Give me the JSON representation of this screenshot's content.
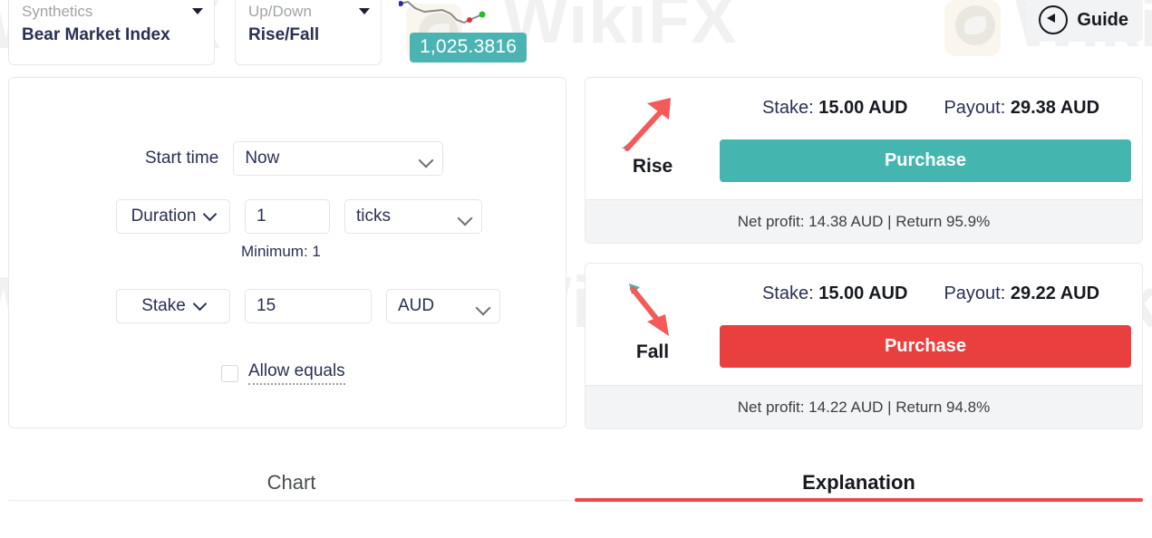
{
  "market_selector": {
    "category": "Synthetics",
    "name": "Bear Market Index",
    "caret_icon": "caret-down-icon"
  },
  "trade_type_selector": {
    "category": "Up/Down",
    "name": "Rise/Fall",
    "caret_icon": "caret-down-icon"
  },
  "ticker": {
    "price": "1,025.3816",
    "badge_color": "#4bb4b3",
    "sparkline_icon": "sparkline-chart"
  },
  "guide": {
    "label": "Guide",
    "icon": "play-circle-icon"
  },
  "form": {
    "start_time": {
      "label": "Start time",
      "value": "Now",
      "chevron_icon": "chevron-down-icon"
    },
    "duration": {
      "type_label": "Duration",
      "type_chevron_icon": "chevron-down-icon",
      "value": "1",
      "unit": "ticks",
      "unit_chevron_icon": "chevron-down-icon",
      "minimum_note": "Minimum: 1"
    },
    "stake": {
      "type_label": "Stake",
      "type_chevron_icon": "chevron-down-icon",
      "value": "15",
      "currency": "AUD",
      "currency_chevron_icon": "chevron-down-icon"
    },
    "allow_equals": {
      "label": "Allow equals",
      "checked": false,
      "checkbox_icon": "checkbox-unchecked-icon"
    }
  },
  "contracts": [
    {
      "direction": "Rise",
      "direction_icon": "arrow-up-right-icon",
      "stake_label": "Stake:",
      "stake_value": "15.00 AUD",
      "payout_label": "Payout:",
      "payout_value": "29.38 AUD",
      "button_label": "Purchase",
      "button_color": "#45b5b0",
      "footer": "Net profit: 14.38 AUD | Return 95.9%"
    },
    {
      "direction": "Fall",
      "direction_icon": "arrow-down-right-icon",
      "stake_label": "Stake:",
      "stake_value": "15.00 AUD",
      "payout_label": "Payout:",
      "payout_value": "29.22 AUD",
      "button_label": "Purchase",
      "button_color": "#ea3f3f",
      "footer": "Net profit: 14.22 AUD | Return 94.8%"
    }
  ],
  "tabs": {
    "chart": "Chart",
    "explanation": "Explanation",
    "active": "Explanation",
    "active_underline_color": "#f4444d"
  },
  "watermarks": {
    "text": "WikiFX"
  }
}
